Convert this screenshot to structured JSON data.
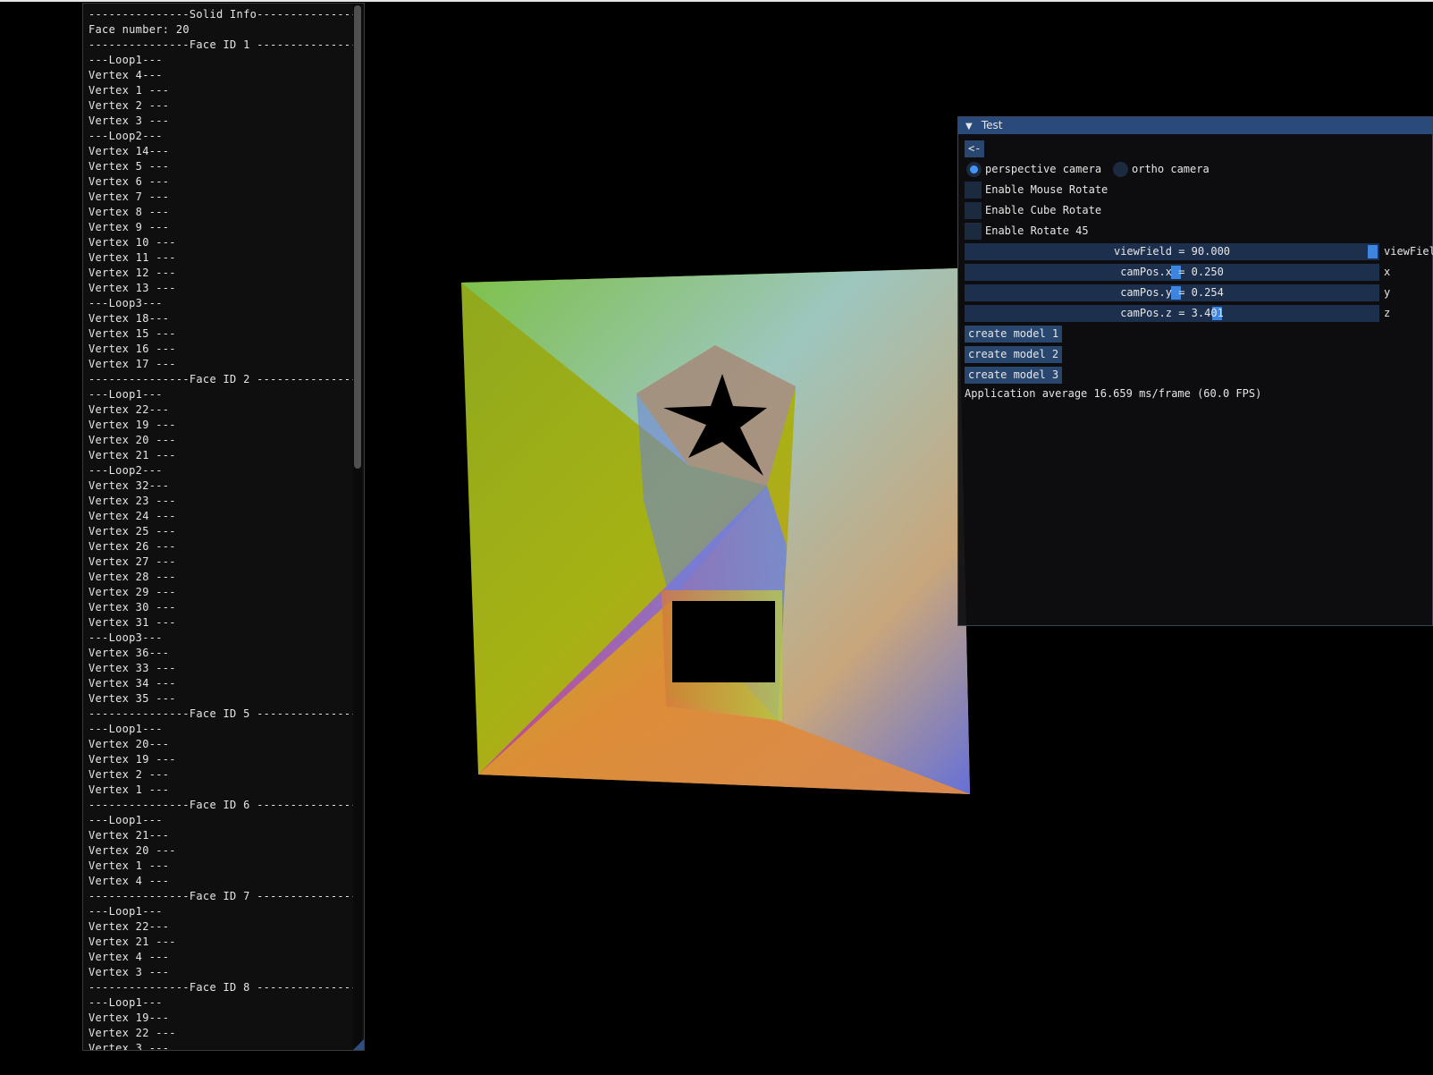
{
  "info_panel": {
    "lines": [
      "---------------Solid Info---------------",
      "Face number: 20",
      "---------------Face ID 1 ---------------",
      "---Loop1---",
      "Vertex 4---",
      "Vertex 1 ---",
      "Vertex 2 ---",
      "Vertex 3 ---",
      "---Loop2---",
      "Vertex 14---",
      "Vertex 5 ---",
      "Vertex 6 ---",
      "Vertex 7 ---",
      "Vertex 8 ---",
      "Vertex 9 ---",
      "Vertex 10 ---",
      "Vertex 11 ---",
      "Vertex 12 ---",
      "Vertex 13 ---",
      "---Loop3---",
      "Vertex 18---",
      "Vertex 15 ---",
      "Vertex 16 ---",
      "Vertex 17 ---",
      "---------------Face ID 2 ---------------",
      "---Loop1---",
      "Vertex 22---",
      "Vertex 19 ---",
      "Vertex 20 ---",
      "Vertex 21 ---",
      "---Loop2---",
      "Vertex 32---",
      "Vertex 23 ---",
      "Vertex 24 ---",
      "Vertex 25 ---",
      "Vertex 26 ---",
      "Vertex 27 ---",
      "Vertex 28 ---",
      "Vertex 29 ---",
      "Vertex 30 ---",
      "Vertex 31 ---",
      "---Loop3---",
      "Vertex 36---",
      "Vertex 33 ---",
      "Vertex 34 ---",
      "Vertex 35 ---",
      "---------------Face ID 5 ---------------",
      "---Loop1---",
      "Vertex 20---",
      "Vertex 19 ---",
      "Vertex 2 ---",
      "Vertex 1 ---",
      "---------------Face ID 6 ---------------",
      "---Loop1---",
      "Vertex 21---",
      "Vertex 20 ---",
      "Vertex 1 ---",
      "Vertex 4 ---",
      "---------------Face ID 7 ---------------",
      "---Loop1---",
      "Vertex 22---",
      "Vertex 21 ---",
      "Vertex 4 ---",
      "Vertex 3 ---",
      "---------------Face ID 8 ---------------",
      "---Loop1---",
      "Vertex 19---",
      "Vertex 22 ---",
      "Vertex 3 ---"
    ]
  },
  "test_window": {
    "title": "Test",
    "back_button": "<-",
    "camera_options": {
      "perspective": "perspective camera",
      "ortho": "ortho camera",
      "selected": "perspective"
    },
    "checkboxes": {
      "mouse_rotate": "Enable Mouse Rotate",
      "cube_rotate": "Enable Cube Rotate",
      "rotate_45": "Enable Rotate 45"
    },
    "sliders": {
      "view_field": {
        "text": "viewField = 90.000",
        "label": "viewFiel",
        "value": 90.0
      },
      "cam_x": {
        "text": "camPos.x = 0.250",
        "label": "x",
        "value": 0.25
      },
      "cam_y": {
        "text": "camPos.y = 0.254",
        "label": "y",
        "value": 0.254
      },
      "cam_z": {
        "text": "camPos.z = 3.401",
        "label": "z",
        "value": 3.401
      }
    },
    "buttons": {
      "model1": "create model 1",
      "model2": "create model 2",
      "model3": "create model 3"
    },
    "fps_text": "Application average 16.659 ms/frame (60.0 FPS)"
  },
  "colors": {
    "title_bar": "#294a7a",
    "button": "#29466f",
    "slider_bg": "#1c2f4d",
    "grab": "#3d85e0",
    "radio_selected": "#4296fa"
  }
}
